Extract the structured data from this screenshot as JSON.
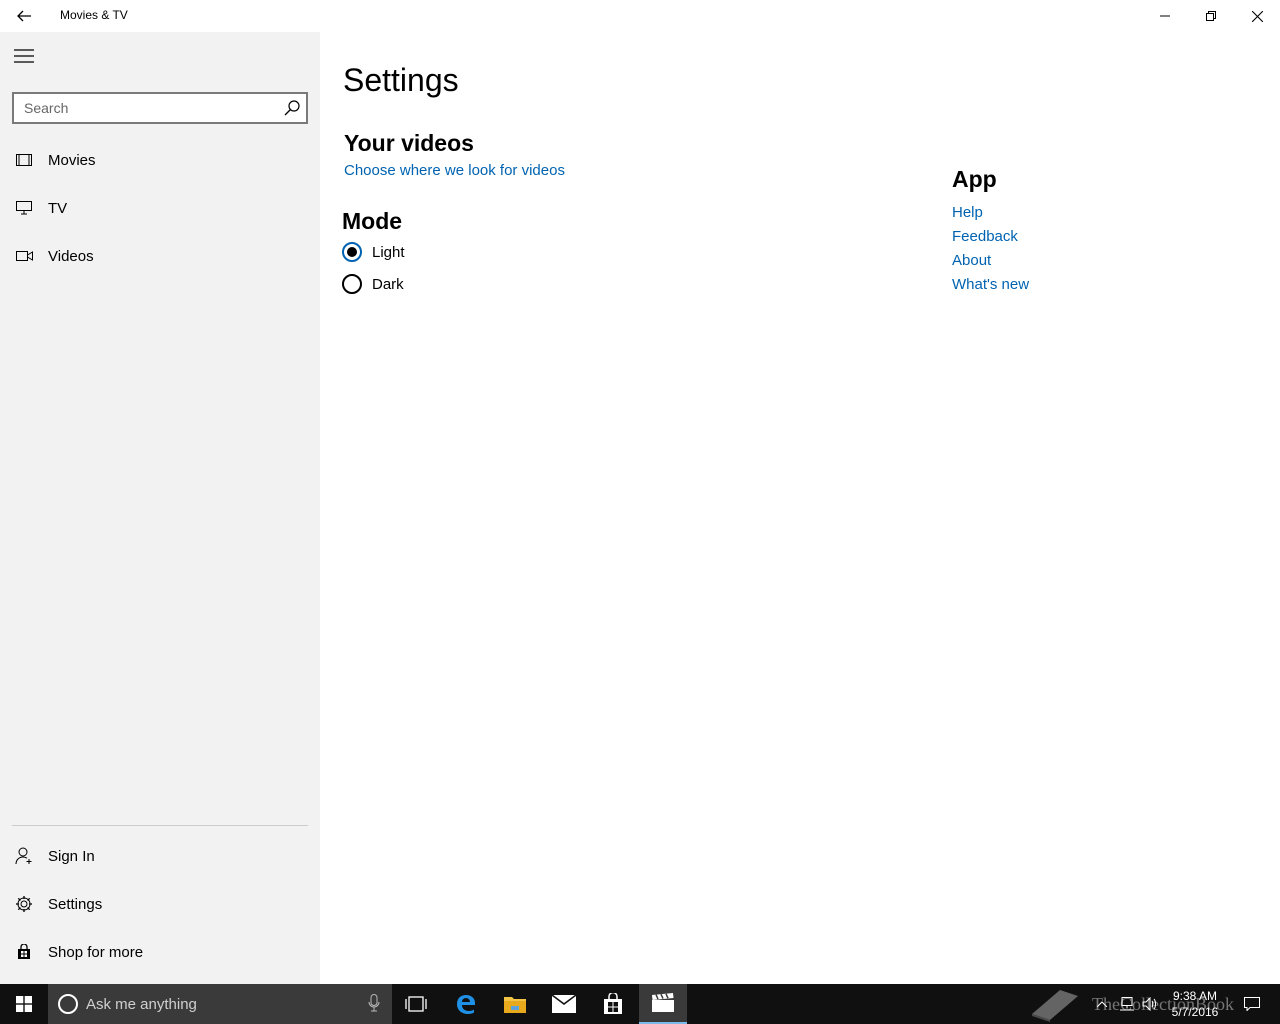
{
  "window": {
    "title": "Movies & TV"
  },
  "sidebar": {
    "search_placeholder": "Search",
    "items": [
      {
        "label": "Movies",
        "icon": "film-icon"
      },
      {
        "label": "TV",
        "icon": "tv-icon"
      },
      {
        "label": "Videos",
        "icon": "video-camera-icon"
      }
    ],
    "bottom_items": [
      {
        "label": "Sign In",
        "icon": "person-icon"
      },
      {
        "label": "Settings",
        "icon": "gear-icon"
      },
      {
        "label": "Shop for more",
        "icon": "store-icon"
      }
    ]
  },
  "main": {
    "title": "Settings",
    "your_videos": {
      "heading": "Your videos",
      "link": "Choose where we look for videos"
    },
    "mode": {
      "heading": "Mode",
      "options": [
        {
          "label": "Light",
          "checked": true
        },
        {
          "label": "Dark",
          "checked": false
        }
      ]
    },
    "app": {
      "heading": "App",
      "links": [
        "Help",
        "Feedback",
        "About",
        "What's new"
      ]
    }
  },
  "taskbar": {
    "search_placeholder": "Ask me anything",
    "time": "9:38 AM",
    "date": "5/7/2016",
    "watermark": "TheCollectionBook"
  },
  "colors": {
    "accent": "#0063b1",
    "sidebar_bg": "#f2f2f2",
    "taskbar_bg": "#101010"
  }
}
